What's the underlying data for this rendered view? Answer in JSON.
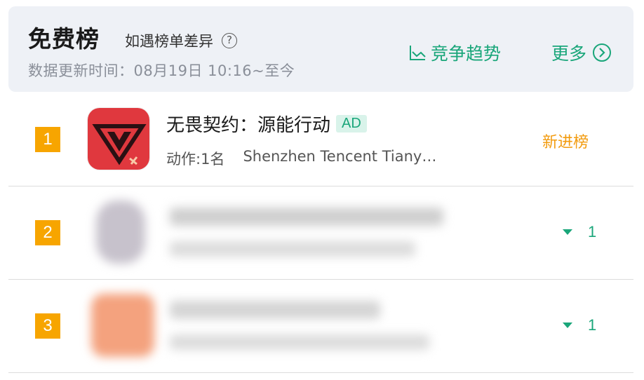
{
  "header": {
    "title": "免费榜",
    "note": "如遇榜单差异",
    "help_icon": "question-circle-icon",
    "updated": "数据更新时间：08月19日 10:16~至今",
    "trend_label": "竞争趋势",
    "trend_icon": "line-chart-icon",
    "more_label": "更多",
    "more_icon": "chevron-right-circle-icon"
  },
  "colors": {
    "accent": "#1aa67a",
    "rank_badge": "#f7a500",
    "new_entry": "#f29b0f",
    "header_bg": "#eef1f6"
  },
  "rows": [
    {
      "rank": "1",
      "name": "无畏契约：源能行动",
      "ad": "AD",
      "category": "动作:1名",
      "developer": "Shenzhen Tencent Tiany…",
      "status": "新进榜"
    },
    {
      "rank": "2",
      "change": "1",
      "change_direction": "down"
    },
    {
      "rank": "3",
      "change": "1",
      "change_direction": "down"
    }
  ]
}
